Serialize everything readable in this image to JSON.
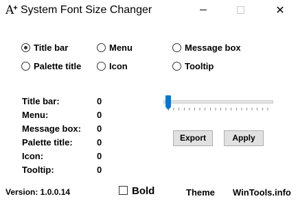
{
  "window": {
    "icon_glyph": "A",
    "icon_plus": "+",
    "title": "System Font Size Changer",
    "controls": {
      "minimize": "",
      "maximize": "",
      "close": "✕"
    }
  },
  "radios": [
    {
      "label": "Title bar",
      "selected": true
    },
    {
      "label": "Menu",
      "selected": false
    },
    {
      "label": "Message box",
      "selected": false
    },
    {
      "label": "Palette title",
      "selected": false
    },
    {
      "label": "Icon",
      "selected": false
    },
    {
      "label": "Tooltip",
      "selected": false
    }
  ],
  "sizes": [
    {
      "label": "Title bar:",
      "value": "0"
    },
    {
      "label": "Menu:",
      "value": "0"
    },
    {
      "label": "Message box:",
      "value": "0"
    },
    {
      "label": "Palette title:",
      "value": "0"
    },
    {
      "label": "Icon:",
      "value": "0"
    },
    {
      "label": "Tooltip:",
      "value": "0"
    }
  ],
  "slider": {
    "value": 0,
    "min": 0,
    "max": 20,
    "accent_color": "#0078d7"
  },
  "buttons": {
    "export": "Export",
    "apply": "Apply"
  },
  "footer": {
    "version": "Version: 1.0.0.14",
    "bold_label": "Bold",
    "bold_checked": false,
    "theme": "Theme",
    "site": "WinTools.info"
  },
  "icons": {
    "app": "app-font-icon",
    "minimize": "minimize-icon",
    "maximize": "maximize-icon",
    "close": "close-icon"
  }
}
